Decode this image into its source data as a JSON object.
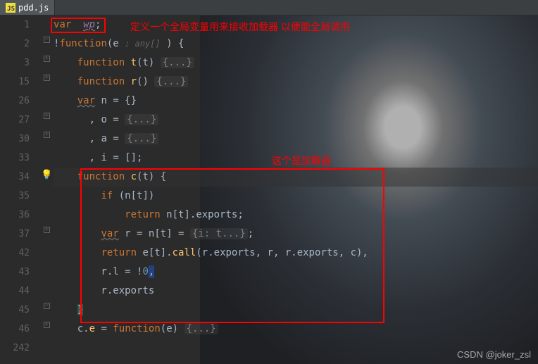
{
  "tab": {
    "filename": "pdd.js"
  },
  "lines": [
    {
      "num": "1",
      "fold": "",
      "html": "<span class='kw'>var</span>  <span class='var-name wavy'>wp</span><span class='punct'>;</span>"
    },
    {
      "num": "2",
      "fold": "⊟",
      "html": "<span class='punct'>!</span><span class='kw'>function</span><span class='punct'>(</span>e <span class='hint'>: any[]</span> <span class='punct'>) {</span>"
    },
    {
      "num": "3",
      "fold": "⊞",
      "html": "    <span class='kw'>function</span> <span class='fn'>t</span><span class='punct'>(t)</span> <span class='fold'>{...}</span>"
    },
    {
      "num": "15",
      "fold": "⊞",
      "html": "    <span class='kw'>function</span> <span class='fn'>r</span><span class='punct'>()</span> <span class='fold'>{...}</span>"
    },
    {
      "num": "26",
      "fold": "",
      "html": "    <span class='kw squiggle'>var</span> n <span class='punct'>= {}</span>"
    },
    {
      "num": "27",
      "fold": "⊞",
      "html": "      <span class='punct'>,</span> o <span class='punct'>=</span> <span class='fold'>{...}</span>"
    },
    {
      "num": "30",
      "fold": "⊞",
      "html": "      <span class='punct'>,</span> a <span class='punct'>=</span> <span class='fold'>{...}</span>"
    },
    {
      "num": "33",
      "fold": "",
      "html": "      <span class='punct'>,</span> i <span class='punct'>= [];</span>"
    },
    {
      "num": "34",
      "fold": "⊟",
      "html": "    <span class='kw'>function</span> <span class='fn'>c</span><span class='punct'>(t)</span> <span class='punct'>{</span>",
      "highlight": true,
      "bulb": true
    },
    {
      "num": "35",
      "fold": "",
      "html": "        <span class='kw'>if</span> <span class='punct'>(</span>n<span class='punct'>[</span>t<span class='punct'>])</span>"
    },
    {
      "num": "36",
      "fold": "",
      "html": "            <span class='kw'>return</span> n<span class='punct'>[</span>t<span class='punct'>].</span>exports<span class='punct'>;</span>"
    },
    {
      "num": "37",
      "fold": "⊞",
      "html": "        <span class='kw squiggle'>var</span> r <span class='punct'>=</span> n<span class='punct'>[</span>t<span class='punct'>] =</span> <span class='fold'>{i: t...}</span><span class='punct'>;</span>"
    },
    {
      "num": "42",
      "fold": "",
      "html": "        <span class='kw'>return</span> e<span class='punct'>[</span>t<span class='punct'>].</span><span class='fn'>call</span><span class='punct'>(</span>r<span class='punct'>.</span>exports<span class='punct'>,</span> r<span class='punct'>,</span> r<span class='punct'>.</span>exports<span class='punct'>,</span> c<span class='punct'>),</span>"
    },
    {
      "num": "43",
      "fold": "",
      "html": "        r<span class='punct'>.</span>l <span class='punct'>= !</span><span class='num'>0</span><span class='caret-hl'><span class='punct'>,</span></span>"
    },
    {
      "num": "44",
      "fold": "",
      "html": "        r<span class='punct'>.</span>exports"
    },
    {
      "num": "45",
      "fold": "⊟",
      "html": "    <span class='punct' style='background:#3b514d'>}</span>"
    },
    {
      "num": "46",
      "fold": "⊞",
      "html": "    c<span class='punct'>.</span><span class='fn'>e</span> <span class='punct'>=</span> <span class='kw'>function</span><span class='punct'>(</span>e<span class='punct'>)</span> <span class='fold'>{...}</span>"
    },
    {
      "num": "242",
      "fold": "",
      "html": ""
    }
  ],
  "annotations": {
    "top_comment": "定义一个全局变量用来接收加载器 以便能全局调用",
    "mid_comment": "这个是加载器"
  },
  "watermark": "CSDN @joker_zsl"
}
